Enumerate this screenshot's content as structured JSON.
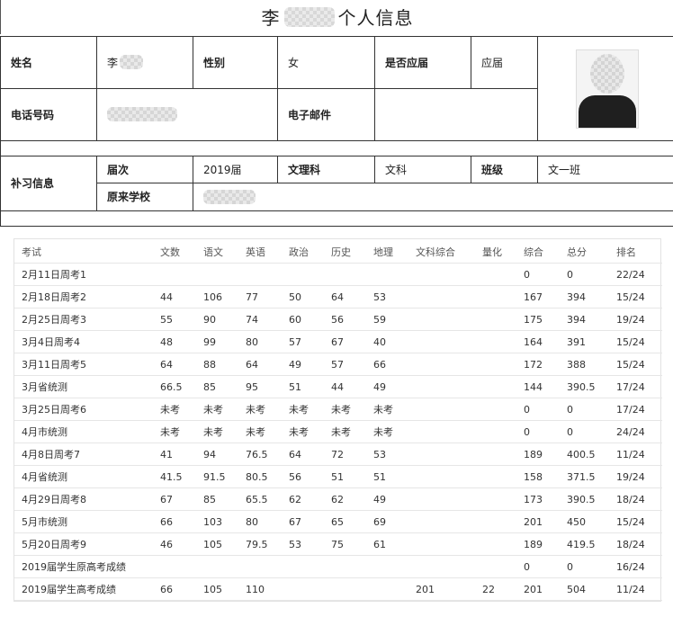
{
  "page": {
    "title_prefix": "李",
    "title_suffix": "个人信息"
  },
  "info": {
    "name_label": "姓名",
    "name_value": "李",
    "gender_label": "性别",
    "gender_value": "女",
    "fresh_label": "是否应届",
    "fresh_value": "应届",
    "phone_label": "电话号码",
    "email_label": "电子邮件",
    "tutor_label": "补习信息",
    "session_label": "届次",
    "session_value": "2019届",
    "track_label": "文理科",
    "track_value": "文科",
    "class_label": "班级",
    "class_value": "文一班",
    "school_label": "原来学校"
  },
  "scores": {
    "columns": [
      "考试",
      "文数",
      "语文",
      "英语",
      "政治",
      "历史",
      "地理",
      "文科综合",
      "量化",
      "综合",
      "总分",
      "排名"
    ],
    "rows": [
      [
        "2月11日周考1",
        "",
        "",
        "",
        "",
        "",
        "",
        "",
        "",
        "0",
        "0",
        "22/24"
      ],
      [
        "2月18日周考2",
        "44",
        "106",
        "77",
        "50",
        "64",
        "53",
        "",
        "",
        "167",
        "394",
        "15/24"
      ],
      [
        "2月25日周考3",
        "55",
        "90",
        "74",
        "60",
        "56",
        "59",
        "",
        "",
        "175",
        "394",
        "19/24"
      ],
      [
        "3月4日周考4",
        "48",
        "99",
        "80",
        "57",
        "67",
        "40",
        "",
        "",
        "164",
        "391",
        "15/24"
      ],
      [
        "3月11日周考5",
        "64",
        "88",
        "64",
        "49",
        "57",
        "66",
        "",
        "",
        "172",
        "388",
        "15/24"
      ],
      [
        "3月省统测",
        "66.5",
        "85",
        "95",
        "51",
        "44",
        "49",
        "",
        "",
        "144",
        "390.5",
        "17/24"
      ],
      [
        "3月25日周考6",
        "未考",
        "未考",
        "未考",
        "未考",
        "未考",
        "未考",
        "",
        "",
        "0",
        "0",
        "17/24"
      ],
      [
        "4月市统测",
        "未考",
        "未考",
        "未考",
        "未考",
        "未考",
        "未考",
        "",
        "",
        "0",
        "0",
        "24/24"
      ],
      [
        "4月8日周考7",
        "41",
        "94",
        "76.5",
        "64",
        "72",
        "53",
        "",
        "",
        "189",
        "400.5",
        "11/24"
      ],
      [
        "4月省统测",
        "41.5",
        "91.5",
        "80.5",
        "56",
        "51",
        "51",
        "",
        "",
        "158",
        "371.5",
        "19/24"
      ],
      [
        "4月29日周考8",
        "67",
        "85",
        "65.5",
        "62",
        "62",
        "49",
        "",
        "",
        "173",
        "390.5",
        "18/24"
      ],
      [
        "5月市统测",
        "66",
        "103",
        "80",
        "67",
        "65",
        "69",
        "",
        "",
        "201",
        "450",
        "15/24"
      ],
      [
        "5月20日周考9",
        "46",
        "105",
        "79.5",
        "53",
        "75",
        "61",
        "",
        "",
        "189",
        "419.5",
        "18/24"
      ],
      [
        "2019届学生原高考成绩",
        "",
        "",
        "",
        "",
        "",
        "",
        "",
        "",
        "0",
        "0",
        "16/24"
      ],
      [
        "2019届学生高考成绩",
        "66",
        "105",
        "110",
        "",
        "",
        "",
        "201",
        "22",
        "201",
        "504",
        "11/24"
      ]
    ]
  }
}
